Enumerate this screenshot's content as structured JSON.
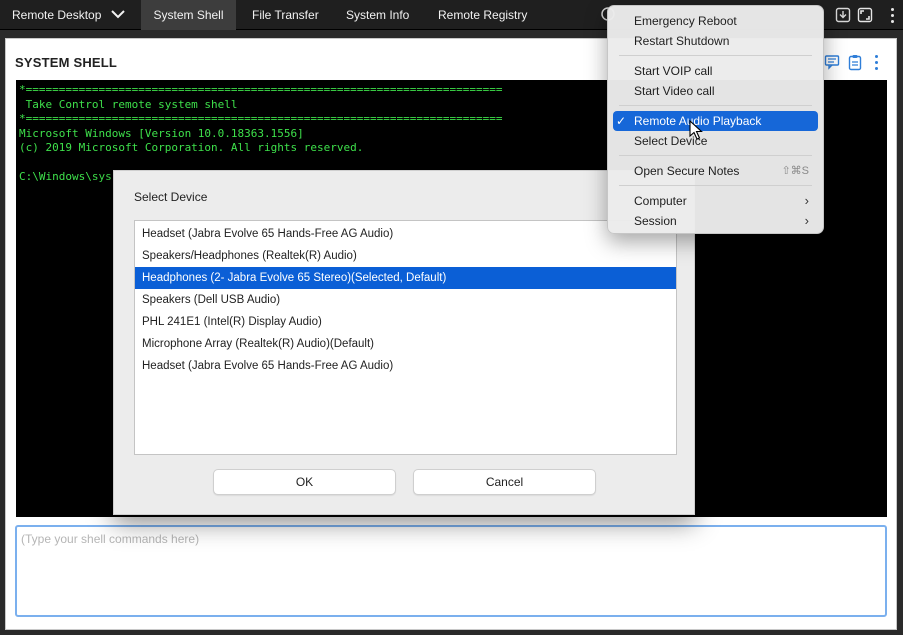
{
  "topbar": {
    "tabs": [
      {
        "label": "Remote Desktop",
        "chevron": "❯"
      },
      {
        "label": "System Shell"
      },
      {
        "label": "File Transfer"
      },
      {
        "label": "System Info"
      },
      {
        "label": "Remote Registry"
      }
    ],
    "icons": [
      "download-icon",
      "fullscreen-icon",
      "more-vertical-icon"
    ]
  },
  "page": {
    "title": "SYSTEM SHELL",
    "tool_icons": [
      "chat-icon",
      "clipboard-icon",
      "more-vertical-icon"
    ]
  },
  "console": {
    "lines": [
      "*========================================================================",
      " Take Control remote system shell",
      "*========================================================================",
      "Microsoft Windows [Version 10.0.18363.1556]",
      "(c) 2019 Microsoft Corporation. All rights reserved.",
      "",
      "C:\\Windows\\sys"
    ]
  },
  "command_input": {
    "placeholder": "(Type your shell commands here)"
  },
  "dialog": {
    "title": "Select Device",
    "devices": [
      "Headset (Jabra Evolve 65 Hands-Free AG Audio)",
      "Speakers/Headphones (Realtek(R) Audio)",
      "Headphones (2- Jabra Evolve 65 Stereo)(Selected, Default)",
      "Speakers (Dell USB Audio)",
      "PHL 241E1 (Intel(R) Display Audio)",
      "Microphone Array (Realtek(R) Audio)(Default)",
      "Headset (Jabra Evolve 65 Hands-Free AG Audio)"
    ],
    "selected_index": 2,
    "ok_label": "OK",
    "cancel_label": "Cancel"
  },
  "menu": {
    "groups": [
      [
        {
          "label": "Emergency Reboot"
        },
        {
          "label": "Restart Shutdown"
        }
      ],
      [
        {
          "label": "Start VOIP call"
        },
        {
          "label": "Start Video call"
        }
      ],
      [
        {
          "label": "Remote Audio Playback",
          "checked": true,
          "highlighted": true,
          "check": "✓"
        },
        {
          "label": "Select Device"
        }
      ],
      [
        {
          "label": "Open Secure Notes",
          "shortcut": "⇧⌘S"
        }
      ],
      [
        {
          "label": "Computer",
          "submenu": true,
          "arrow": "›"
        },
        {
          "label": "Session",
          "submenu": true,
          "arrow": "›"
        }
      ]
    ]
  },
  "colors": {
    "accent": "#1667d8",
    "console_text": "#3ee04b",
    "list_selection": "#0b5fd6"
  }
}
